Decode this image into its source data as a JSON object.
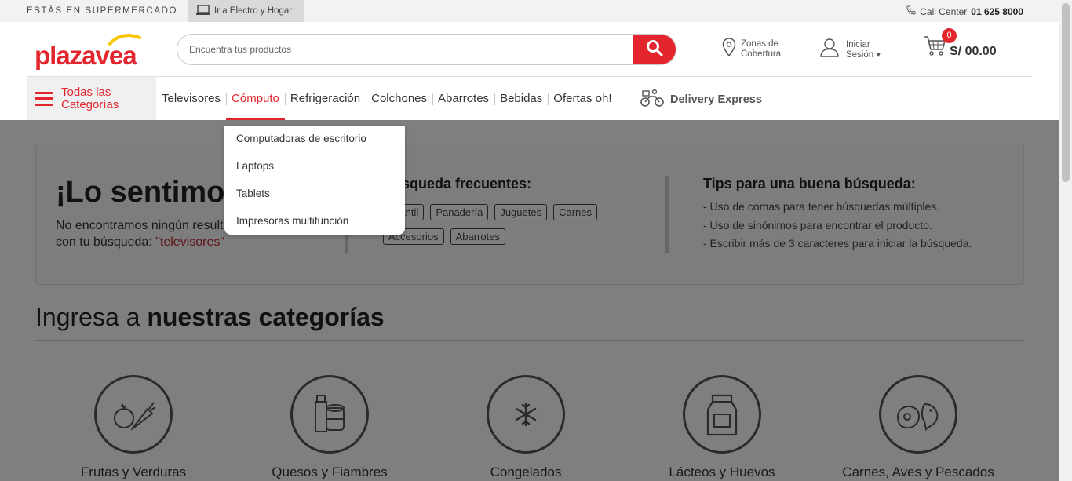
{
  "topbar": {
    "market_label": "ESTÁS EN SUPERMERCADO",
    "electro_link": "Ir a Electro y Hogar",
    "call_center_label": "Call Center",
    "call_center_number": "01 625 8000"
  },
  "header": {
    "logo_text": "plazavea",
    "search_placeholder": "Encuentra tus productos",
    "zonas_line1": "Zonas de",
    "zonas_line2": "Cobertura",
    "login_line1": "Iniciar",
    "login_line2": "Sesión ▾",
    "cart_count": "0",
    "cart_total": "S/ 00.00"
  },
  "nav": {
    "all_categories": "Todas las Categorías",
    "items": [
      "Televisores",
      "Cómputo",
      "Refrigeración",
      "Colchones",
      "Abarrotes",
      "Bebidas",
      "Ofertas oh!"
    ],
    "active_index": 1,
    "delivery": "Delivery Express"
  },
  "dropdown": {
    "items": [
      "Computadoras de escritorio",
      "Laptops",
      "Tablets",
      "Impresoras multifunción"
    ]
  },
  "not_found": {
    "title": "¡Lo sentimos!",
    "message": "No encontramos ningún resultado que coincida con tu búsqueda:",
    "query": "\"televisores\"",
    "frequent_title": "Búsqueda frecuentes:",
    "frequent": [
      "Infantil",
      "Panadería",
      "Juguetes",
      "Carnes",
      "Accesorios",
      "Abarrotes"
    ],
    "tips_title": "Tips para una buena búsqueda:",
    "tips": [
      "- Uso de comas para tener búsquedas múltiples.",
      "- Uso de sinónimos para encontrar el producto.",
      "- Escribir más de 3 caracteres para iniciar la búsqueda."
    ]
  },
  "categories": {
    "heading_light": "Ingresa a",
    "heading_bold": "nuestras categorías",
    "items": [
      "Frutas y Verduras",
      "Quesos y Fiambres",
      "Congelados",
      "Lácteos y Huevos",
      "Carnes, Aves y Pescados"
    ]
  },
  "colors": {
    "brand_red": "#e3262d",
    "brand_yellow": "#f7c600"
  }
}
